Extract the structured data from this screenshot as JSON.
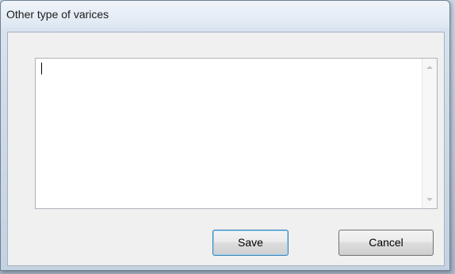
{
  "dialog": {
    "title": "Other type of varices",
    "text_value": "",
    "buttons": {
      "save_label": "Save",
      "cancel_label": "Cancel"
    }
  },
  "icons": {
    "scroll_up": "chevron-up-icon",
    "scroll_down": "chevron-down-icon"
  }
}
